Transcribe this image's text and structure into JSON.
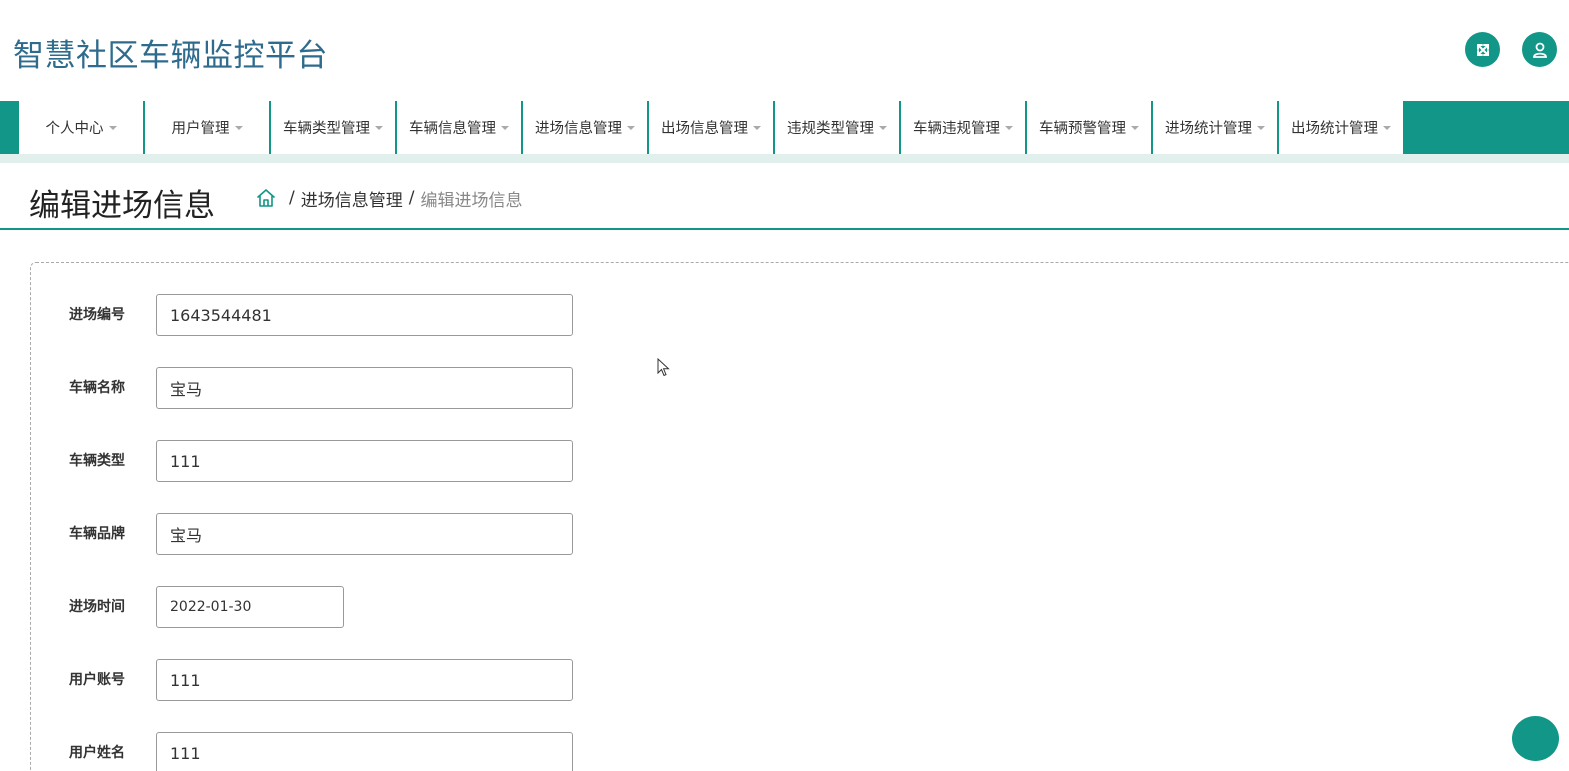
{
  "header": {
    "title": "智慧社区车辆监控平台"
  },
  "nav": {
    "items": [
      {
        "label": "个人中心"
      },
      {
        "label": "用户管理"
      },
      {
        "label": "车辆类型管理"
      },
      {
        "label": "车辆信息管理"
      },
      {
        "label": "进场信息管理"
      },
      {
        "label": "出场信息管理"
      },
      {
        "label": "违规类型管理"
      },
      {
        "label": "车辆违规管理"
      },
      {
        "label": "车辆预警管理"
      },
      {
        "label": "进场统计管理"
      },
      {
        "label": "出场统计管理"
      }
    ]
  },
  "page": {
    "title": "编辑进场信息",
    "breadcrumb": {
      "sep": "/",
      "parent": "进场信息管理",
      "current": "编辑进场信息"
    }
  },
  "form": {
    "fields": [
      {
        "label": "进场编号",
        "value": "1643544481"
      },
      {
        "label": "车辆名称",
        "value": "宝马"
      },
      {
        "label": "车辆类型",
        "value": "111"
      },
      {
        "label": "车辆品牌",
        "value": "宝马"
      },
      {
        "label": "进场时间",
        "value": "2022-01-30"
      },
      {
        "label": "用户账号",
        "value": "111"
      },
      {
        "label": "用户姓名",
        "value": "111"
      }
    ]
  },
  "colors": {
    "accent": "#119687",
    "title": "#2e6b8c",
    "strip": "#e1f0ec"
  },
  "icons": {
    "fullscreen": "expand-arrows-icon",
    "user": "user-icon",
    "home": "home-icon"
  }
}
